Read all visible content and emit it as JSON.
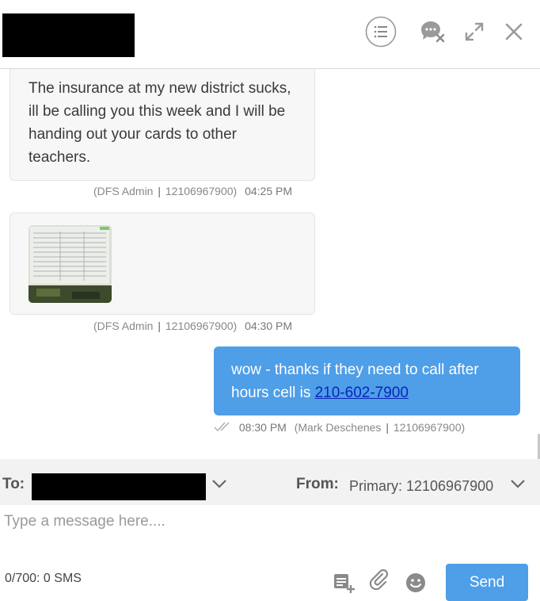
{
  "header": {
    "icons": [
      "list-icon",
      "chat-close-icon",
      "expand-icon",
      "close-icon"
    ]
  },
  "messages": [
    {
      "direction": "incoming",
      "text": "The insurance at my new district sucks, ill be calling you this week and I will be handing out your cards to other teachers.",
      "sender": "(DFS Admin",
      "number": "12106967900)",
      "time": "04:25 PM"
    },
    {
      "direction": "incoming",
      "attachment": "image-thumbnail",
      "sender": "(DFS Admin",
      "number": "12106967900)",
      "time": "04:30 PM"
    },
    {
      "direction": "outgoing",
      "text_prefix": "wow - thanks if they need to call after hours cell is ",
      "link": "210-602-7900",
      "time": "08:30 PM",
      "sender": "(Mark Deschenes",
      "number": "12106967900)"
    }
  ],
  "toolbar": {
    "to_label": "To:",
    "from_label": "From:",
    "from_value": "Primary: 12106967900"
  },
  "compose": {
    "placeholder": "Type a message here....",
    "counter": "0/700: 0 SMS",
    "send_label": "Send"
  },
  "colors": {
    "accent": "#4e9ee8",
    "link": "#0a26b8"
  }
}
